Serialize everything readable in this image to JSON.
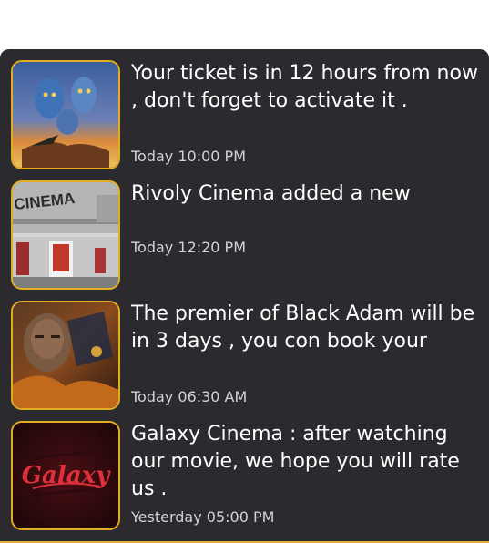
{
  "notifications": [
    {
      "message": "Your ticket is in 12 hours from now , don't forget to activate it .",
      "time": "Today 10:00 PM",
      "thumbnail_icon": "avatar-poster-thumbnail"
    },
    {
      "message": "Rivoly Cinema added a new",
      "time": "Today 12:20 PM",
      "thumbnail_icon": "cinema-building-thumbnail",
      "thumbnail_text": "CINEMA"
    },
    {
      "message": "The premier of Black Adam will be in 3 days , you con book your",
      "time": "Today 06:30 AM",
      "thumbnail_icon": "black-adam-poster-thumbnail"
    },
    {
      "message": "Galaxy Cinema : after watching our movie, we hope you will rate us .",
      "time": "Yesterday 05:00 PM",
      "thumbnail_icon": "galaxy-logo-thumbnail",
      "thumbnail_text": "Galaxy"
    }
  ],
  "colors": {
    "panel_background": "#2b2a2e",
    "thumbnail_border": "#e3ad22",
    "message_text": "#ffffff",
    "time_text": "#d3d3d3"
  }
}
